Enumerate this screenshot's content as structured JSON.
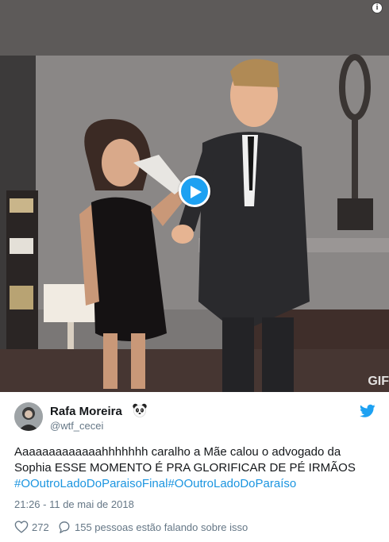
{
  "tweet": {
    "media": {
      "info_icon": "info-icon",
      "play_icon": "play-icon",
      "gif_badge": "GIF"
    },
    "author": {
      "display_name": "Rafa Moreira",
      "emoji": "panda-icon",
      "handle": "@wtf_cecei"
    },
    "text_plain": "Aaaaaaaaaaaaahhhhhhh caralho a Mãe calou o advogado da Sophia ESSE MOMENTO É PRA GLORIFICAR DE PÉ IRMÃOS ",
    "hashtags": [
      "#OOutroLadoDoParaisoFinal",
      "#OOutroLadoDoParaíso"
    ],
    "timestamp": "21:26 - 11 de mai de 2018",
    "likes": "272",
    "replies_text": "155 pessoas estão falando sobre isso",
    "colors": {
      "accent": "#1da1f2",
      "hashtag": "#1b95e0",
      "muted": "#657786",
      "text": "#14171a"
    }
  }
}
